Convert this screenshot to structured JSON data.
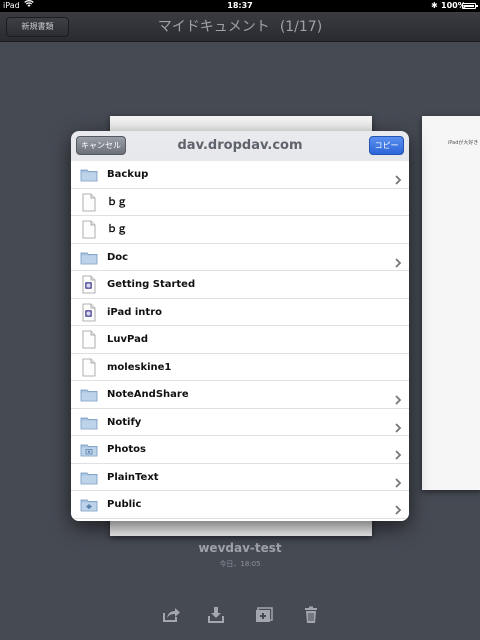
{
  "status_bar": {
    "carrier": "iPad",
    "time": "18:37",
    "battery_text": "100%"
  },
  "navbar": {
    "new_doc_label": "新規書類",
    "title": "マイドキュメント",
    "count": "(1/17)"
  },
  "background": {
    "right_doc_snippet": "iPadが大好き"
  },
  "popover": {
    "cancel_label": "キャンセル",
    "title": "dav.dropdav.com",
    "copy_label": "コピー",
    "items": [
      {
        "name": "Backup",
        "icon": "folder-icon",
        "chevron": true
      },
      {
        "name": "ｂｇ",
        "icon": "document-icon",
        "chevron": false
      },
      {
        "name": "ｂｇ",
        "icon": "document-icon",
        "chevron": false
      },
      {
        "name": "Doc",
        "icon": "folder-icon",
        "chevron": true
      },
      {
        "name": "Getting Started",
        "icon": "app-document-icon",
        "chevron": false
      },
      {
        "name": "iPad intro",
        "icon": "app-document-icon",
        "chevron": false
      },
      {
        "name": "LuvPad",
        "icon": "document-icon",
        "chevron": false
      },
      {
        "name": "moleskine1",
        "icon": "document-icon",
        "chevron": false
      },
      {
        "name": "NoteAndShare",
        "icon": "folder-icon",
        "chevron": true
      },
      {
        "name": "Notify",
        "icon": "folder-icon",
        "chevron": true
      },
      {
        "name": "Photos",
        "icon": "photos-folder-icon",
        "chevron": true
      },
      {
        "name": "PlainText",
        "icon": "folder-icon",
        "chevron": true
      },
      {
        "name": "Public",
        "icon": "public-folder-icon",
        "chevron": true
      }
    ]
  },
  "document": {
    "name": "wevdav-test",
    "date": "今日、18:05"
  },
  "toolbar": {
    "icons": [
      "share-icon",
      "download-icon",
      "add-document-icon",
      "trash-icon"
    ]
  },
  "colors": {
    "background": "#464a53",
    "accent_blue": "#2c66d8"
  }
}
